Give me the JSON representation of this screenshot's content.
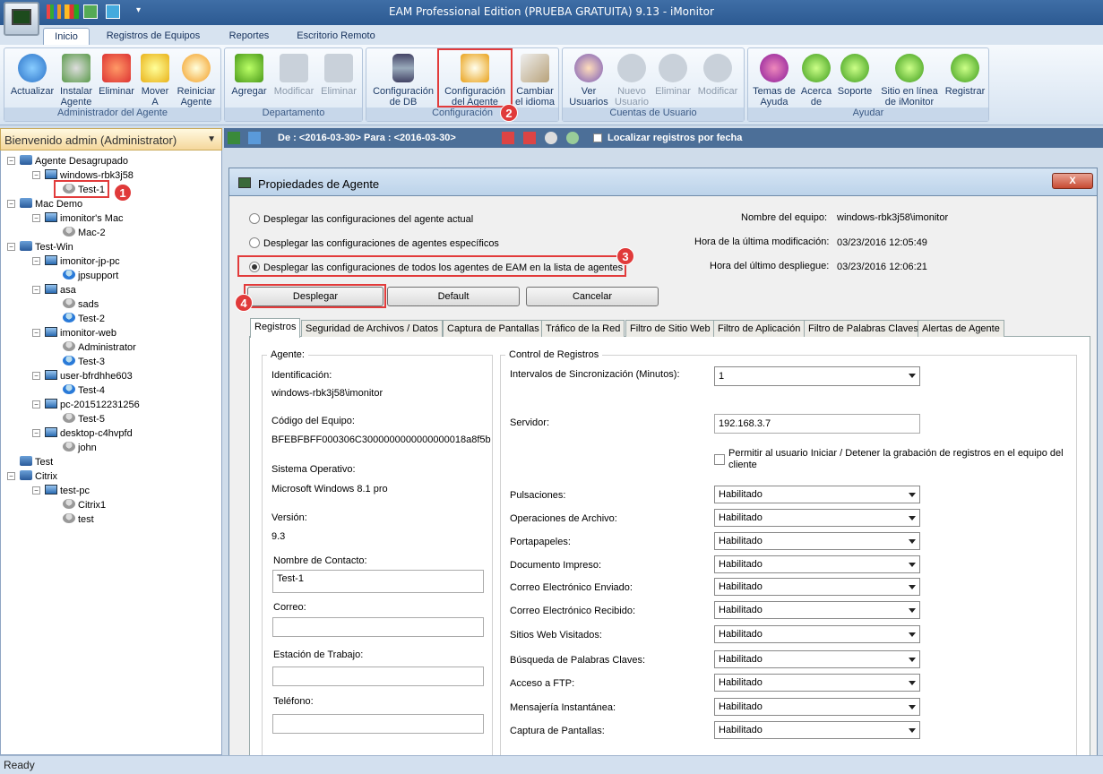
{
  "window": {
    "title": "EAM Professional Edition (PRUEBA GRATUITA) 9.13 - iMonitor"
  },
  "ribbon_tabs": [
    "Inicio",
    "Registros de Equipos",
    "Reportes",
    "Escritorio Remoto"
  ],
  "groups": {
    "agent": {
      "caption": "Administrador del Agente",
      "buttons": [
        "Actualizar",
        "Instalar\nAgente",
        "Eliminar",
        "Mover\nA",
        "Reiniciar\nAgente"
      ]
    },
    "dept": {
      "caption": "Departamento",
      "buttons": [
        "Agregar",
        "Modificar",
        "Eliminar"
      ]
    },
    "config": {
      "caption": "Configuración",
      "buttons": [
        "Configuración\nde DB",
        "Configuración\ndel Agente",
        "Cambiar\nel idioma"
      ]
    },
    "users": {
      "caption": "Cuentas de Usuario",
      "buttons": [
        "Ver\nUsuarios",
        "Nuevo\nUsuario",
        "Eliminar",
        "Modificar"
      ]
    },
    "help": {
      "caption": "Ayudar",
      "buttons": [
        "Temas de\nAyuda",
        "Acerca\nde",
        "Soporte",
        "Sitio en línea\nde iMonitor",
        "Registrar"
      ]
    }
  },
  "badges": [
    "1",
    "2",
    "3",
    "4"
  ],
  "left_panel": {
    "header": "Bienvenido admin (Administrator)",
    "tree": [
      {
        "label": "Agente Desagrupado",
        "level": 0,
        "type": "group"
      },
      {
        "label": "windows-rbk3j58",
        "level": 1,
        "type": "pc"
      },
      {
        "label": "Test-1",
        "level": 2,
        "type": "user-gray"
      },
      {
        "label": "Mac Demo",
        "level": 0,
        "type": "group"
      },
      {
        "label": "imonitor's Mac",
        "level": 1,
        "type": "pc"
      },
      {
        "label": "Mac-2",
        "level": 2,
        "type": "user-gray"
      },
      {
        "label": "Test-Win",
        "level": 0,
        "type": "group"
      },
      {
        "label": "imonitor-jp-pc",
        "level": 1,
        "type": "pc"
      },
      {
        "label": "jpsupport",
        "level": 2,
        "type": "user-blue"
      },
      {
        "label": "asa",
        "level": 1,
        "type": "pc"
      },
      {
        "label": "sads",
        "level": 2,
        "type": "user-gray"
      },
      {
        "label": "Test-2",
        "level": 2,
        "type": "user-blue"
      },
      {
        "label": "imonitor-web",
        "level": 1,
        "type": "pc"
      },
      {
        "label": "Administrator",
        "level": 2,
        "type": "user-gray"
      },
      {
        "label": "Test-3",
        "level": 2,
        "type": "user-blue"
      },
      {
        "label": "user-bfrdhhe603",
        "level": 1,
        "type": "pc"
      },
      {
        "label": "Test-4",
        "level": 2,
        "type": "user-blue"
      },
      {
        "label": "pc-201512231256",
        "level": 1,
        "type": "pc"
      },
      {
        "label": "Test-5",
        "level": 2,
        "type": "user-gray"
      },
      {
        "label": "desktop-c4hvpfd",
        "level": 1,
        "type": "pc"
      },
      {
        "label": "john",
        "level": 2,
        "type": "user-gray"
      },
      {
        "label": "Test",
        "level": 0,
        "type": "group"
      },
      {
        "label": "Citrix",
        "level": 0,
        "type": "group"
      },
      {
        "label": "test-pc",
        "level": 1,
        "type": "pc"
      },
      {
        "label": "Citrix1",
        "level": 2,
        "type": "user-gray"
      },
      {
        "label": "test",
        "level": 2,
        "type": "user-gray"
      }
    ]
  },
  "filter": {
    "date_range": "De : <2016-03-30> Para : <2016-03-30>",
    "locate_label": "Localizar registros por fecha"
  },
  "dialog": {
    "title": "Propiedades de Agente",
    "close_label": "X",
    "radios": [
      "Desplegar las configuraciones del agente actual",
      "Desplegar las configuraciones de agentes específicos",
      "Desplegar las configuraciones de todos los agentes de EAM en la lista de agentes"
    ],
    "info": {
      "equipo_label": "Nombre del equipo:",
      "equipo_value": "windows-rbk3j58\\imonitor",
      "mod_label": "Hora de la última modificación:",
      "mod_value": "03/23/2016 12:05:49",
      "dep_label": "Hora del último despliegue:",
      "dep_value": "03/23/2016 12:06:21"
    },
    "buttons": {
      "deploy": "Desplegar",
      "default": "Default",
      "cancel": "Cancelar"
    },
    "tabs": [
      "Registros",
      "Seguridad de Archivos / Datos",
      "Captura de Pantallas",
      "Tráfico de la Red",
      "Filtro de Sitio Web",
      "Filtro de Aplicación",
      "Filtro de Palabras Claves",
      "Alertas de Agente"
    ],
    "agent": {
      "legend": "Agente:",
      "id_label": "Identificación:",
      "id_value": "windows-rbk3j58\\imonitor",
      "code_label": "Código del Equipo:",
      "code_value": "BFEBFBFF000306C3000000000000000018a8f5b",
      "os_label": "Sistema Operativo:",
      "os_value": "Microsoft Windows 8.1 pro",
      "ver_label": "Versión:",
      "ver_value": "9.3",
      "contact_label": "Nombre de Contacto:",
      "contact_value": "Test-1",
      "mail_label": "Correo:",
      "mail_value": "",
      "ws_label": "Estación de Trabajo:",
      "ws_value": "",
      "phone_label": "Teléfono:",
      "phone_value": ""
    },
    "control": {
      "legend": "Control de Registros",
      "sync_label": "Intervalos de Sincronización (Minutos):",
      "sync_value": "1",
      "server_label": "Servidor:",
      "server_value": "192.168.3.7",
      "allow_label": "Permitir al usuario Iniciar / Detener la grabación de registros en el equipo del cliente",
      "rows": [
        {
          "label": "Pulsaciones:",
          "value": "Habilitado"
        },
        {
          "label": "Operaciones de Archivo:",
          "value": "Habilitado"
        },
        {
          "label": "Portapapeles:",
          "value": "Habilitado"
        },
        {
          "label": "Documento Impreso:",
          "value": "Habilitado"
        },
        {
          "label": "Correo Electrónico Enviado:",
          "value": "Habilitado"
        },
        {
          "label": "Correo Electrónico Recibido:",
          "value": "Habilitado"
        },
        {
          "label": "Sitios Web Visitados:",
          "value": "Habilitado"
        },
        {
          "label": "Búsqueda de Palabras Claves:",
          "value": "Habilitado"
        },
        {
          "label": "Acceso a FTP:",
          "value": "Habilitado"
        },
        {
          "label": "Mensajería Instantánea:",
          "value": "Habilitado"
        },
        {
          "label": "Captura de Pantallas:",
          "value": "Habilitado"
        }
      ]
    }
  },
  "status": {
    "text": "Ready"
  }
}
